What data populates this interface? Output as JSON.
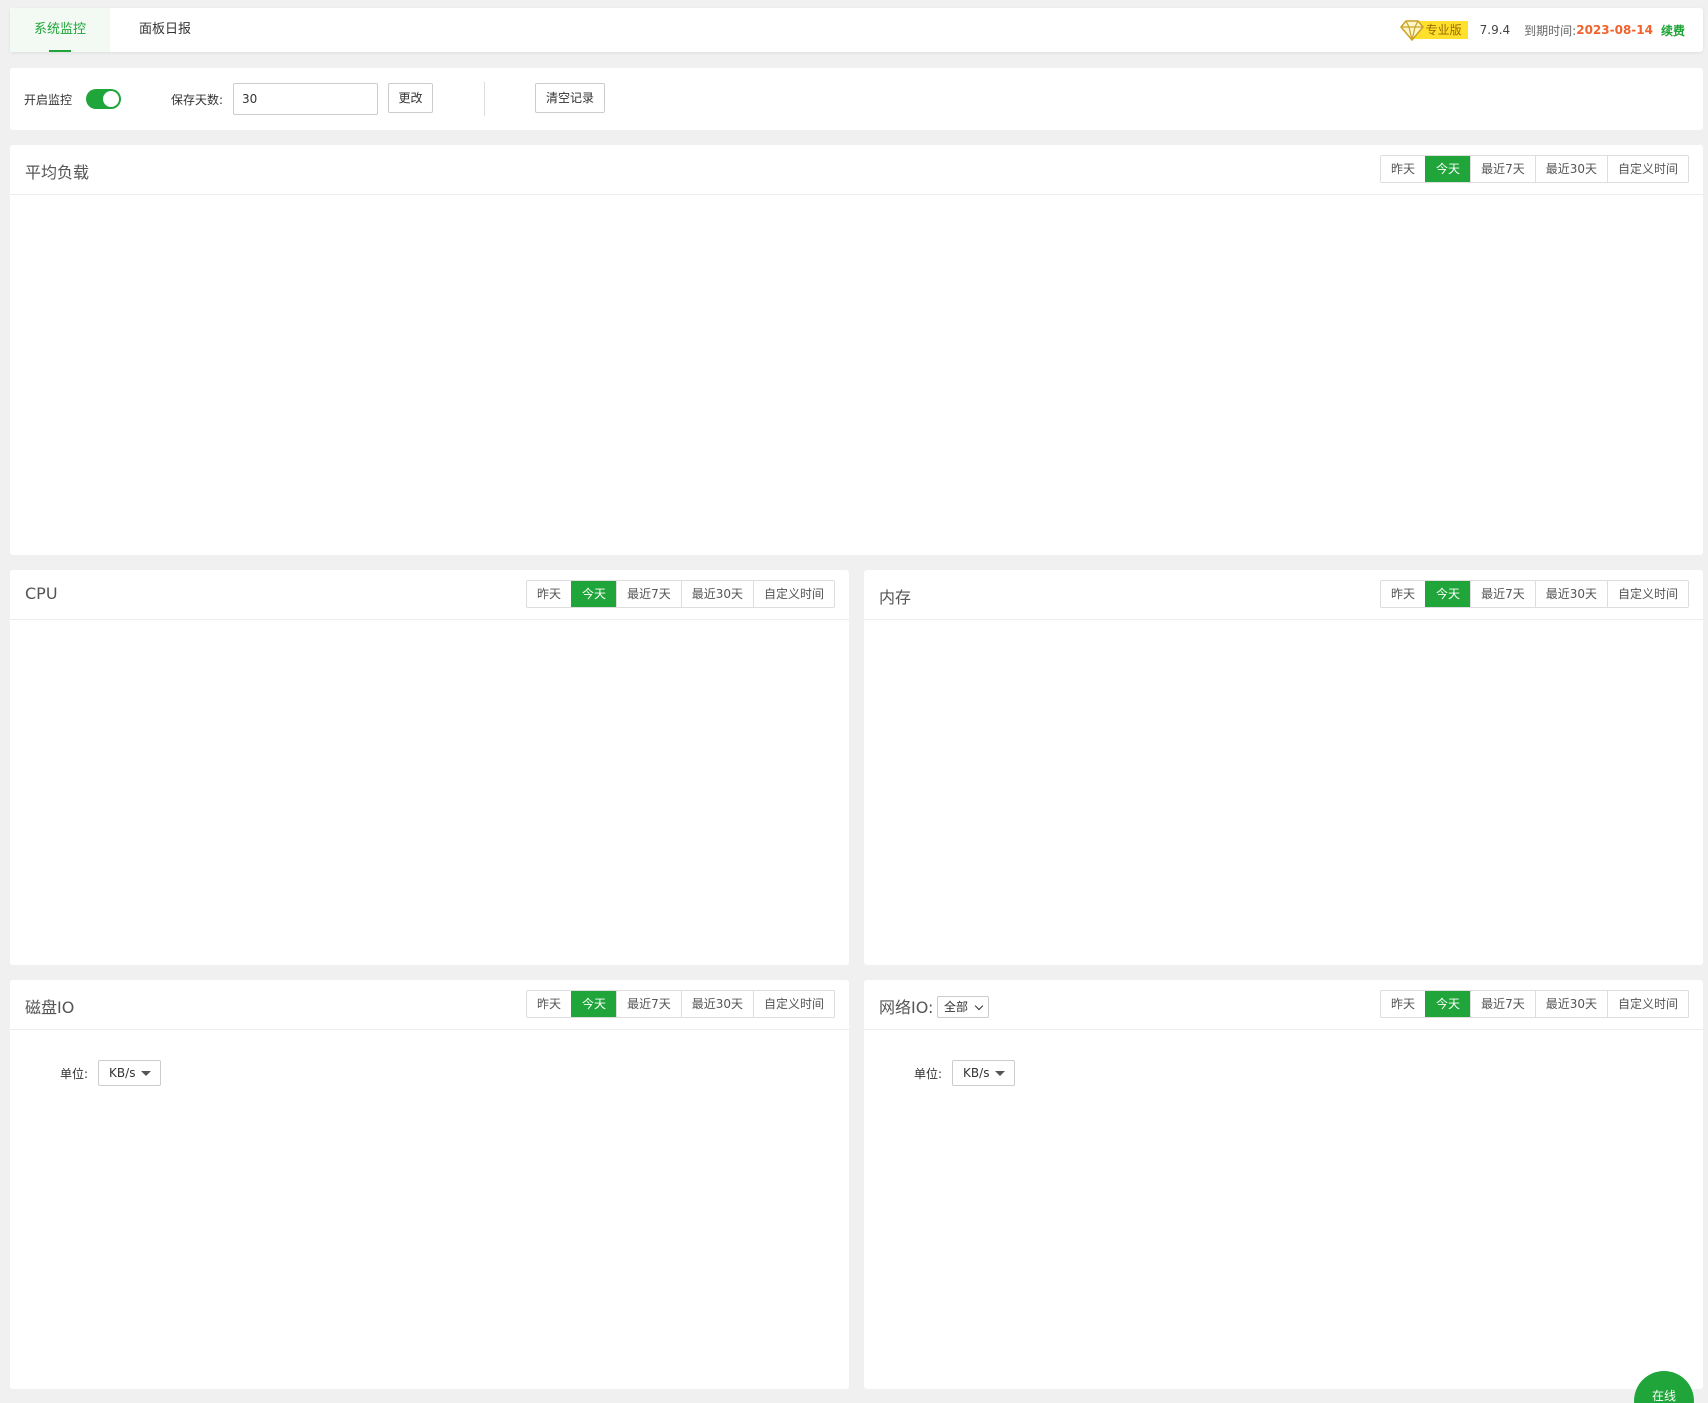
{
  "tabs": [
    "系统监控",
    "面板日报"
  ],
  "header": {
    "pro_label": "专业版",
    "version": "7.9.4",
    "expire_label": "到期时间:",
    "expire_date": "2023-08-14",
    "renew_label": "续费"
  },
  "controls": {
    "monitor_label": "开启监控",
    "monitor_enabled": true,
    "save_days_label": "保存天数:",
    "save_days_value": "30",
    "change_button": "更改",
    "clear_button": "清空记录"
  },
  "range_buttons": [
    "昨天",
    "今天",
    "最近7天",
    "最近30天",
    "自定义时间"
  ],
  "range_active": "今天",
  "panels": {
    "load": {
      "title": "平均负载"
    },
    "cpu": {
      "title": "CPU"
    },
    "memory": {
      "title": "内存"
    },
    "disk": {
      "title": "磁盘IO",
      "unit_label": "单位:",
      "unit_value": "KB/s"
    },
    "network": {
      "title": "网络IO:",
      "filter_value": "全部",
      "unit_label": "单位:",
      "unit_value": "KB/s"
    }
  },
  "online_button": "在线",
  "colors": {
    "accent": "#20a53a",
    "expire": "#f0632e",
    "pro_badge": "#ffe02d"
  }
}
